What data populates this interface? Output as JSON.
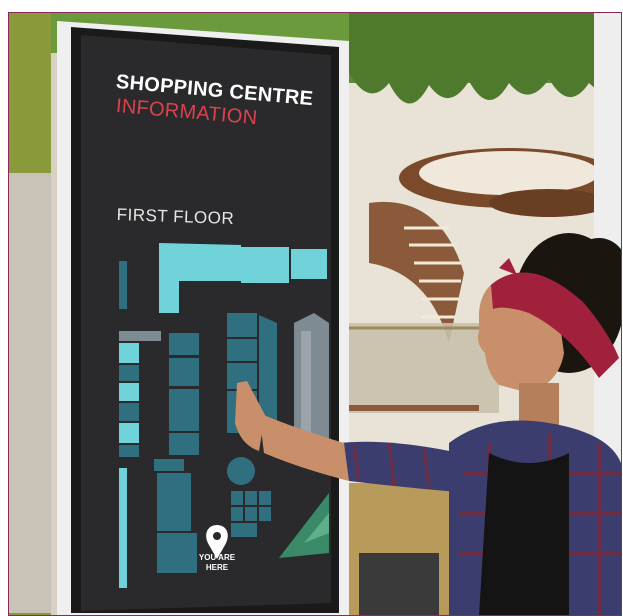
{
  "kiosk": {
    "title_line1": "SHOPPING CENTRE",
    "title_line2": "INFORMATION",
    "floor_label": "FIRST FLOOR",
    "you_are_here": "YOU ARE HERE"
  },
  "colors": {
    "screen": "#2a2a2c",
    "accent_red": "#d8434d",
    "map_cyan": "#6fd3d9",
    "map_teal": "#2f6f80",
    "map_grey": "#7f8b93",
    "map_green": "#3a8a6a",
    "headband": "#a1213c",
    "shirt": "#3b3d6e"
  },
  "icons": [
    "location-pin-icon"
  ]
}
